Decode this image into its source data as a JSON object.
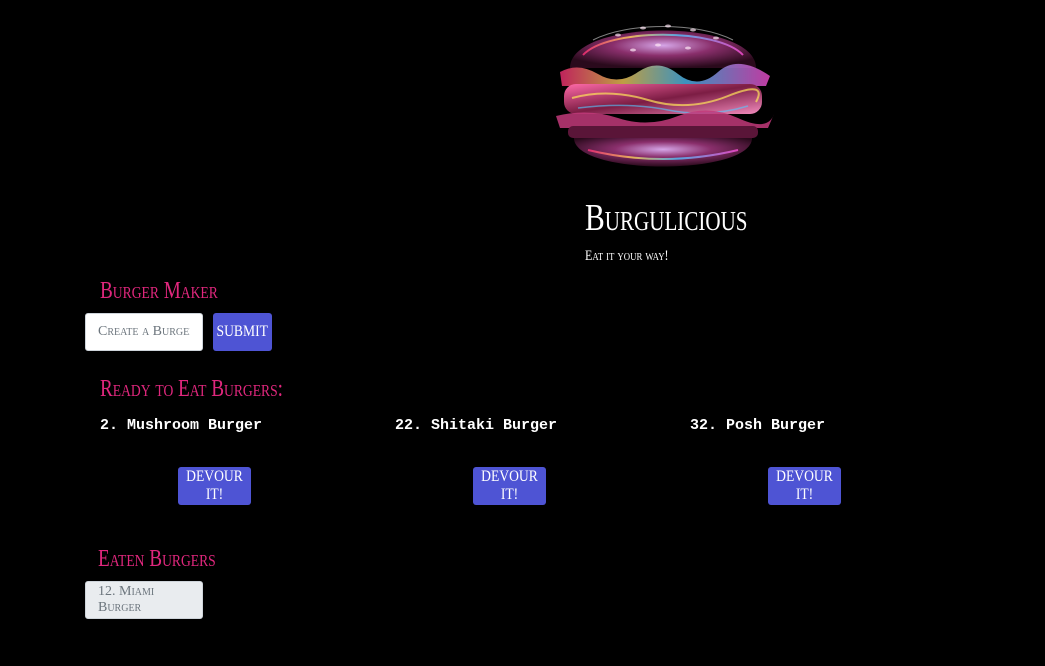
{
  "header": {
    "title": "Burgulicious",
    "tagline": "Eat it your way!"
  },
  "maker": {
    "heading": "Burger Maker",
    "input_placeholder": "Create a Burger",
    "submit_label": "SUBMIT"
  },
  "ready": {
    "heading": "Ready to Eat Burgers:",
    "button_label": "DEVOUR IT!",
    "items": [
      {
        "name": "2. Mushroom Burger"
      },
      {
        "name": "22. Shitaki Burger"
      },
      {
        "name": "32. Posh Burger"
      }
    ]
  },
  "eaten": {
    "heading": "Eaten Burgers",
    "items": [
      {
        "name": "12. Miami Burger"
      }
    ]
  },
  "colors": {
    "background": "#000000",
    "accent_pink": "#e0277d",
    "button_blue": "#4e54d4",
    "text": "#ffffff"
  },
  "icons": {
    "hero": "burger-image"
  }
}
